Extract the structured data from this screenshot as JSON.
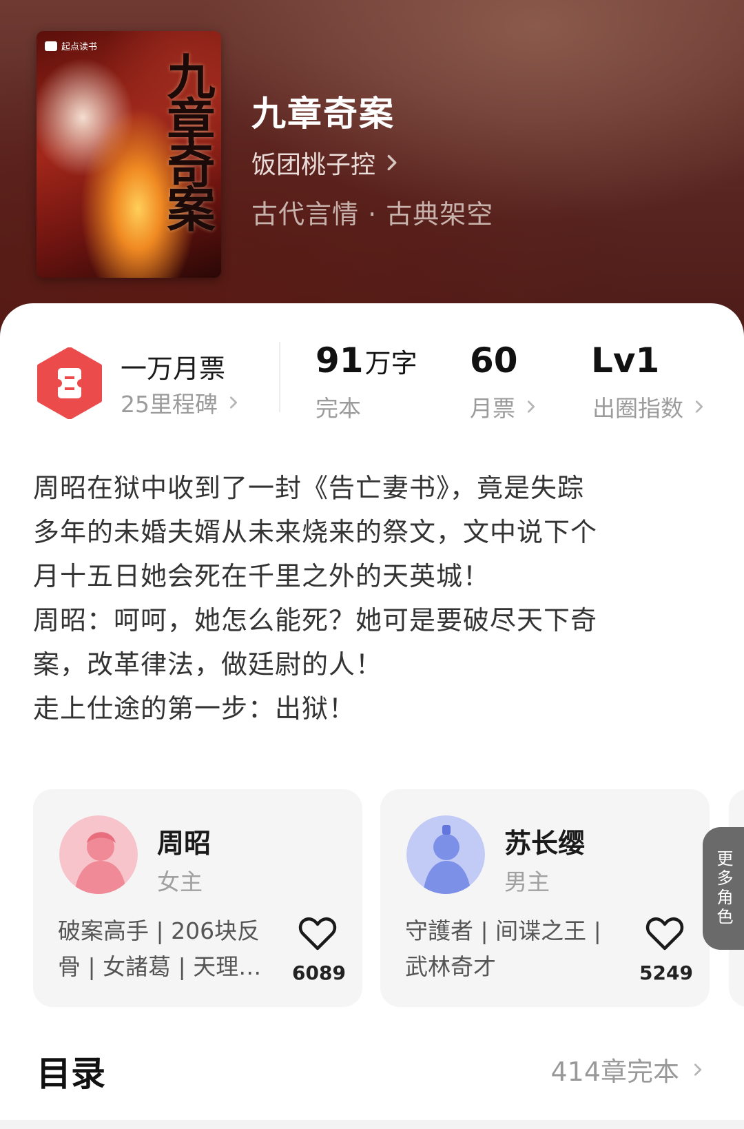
{
  "book": {
    "title": "九章奇案",
    "author": "饭团桃子控",
    "genre": "古代言情 · 古典架空",
    "cover": {
      "brand": "起点读书",
      "title_art": "九章奇案"
    }
  },
  "stats": {
    "ticket_title": "一万月票",
    "milestone": "25里程碑",
    "words_number": "91",
    "words_unit": "万字",
    "words_status": "完本",
    "monthly_votes": "60",
    "monthly_votes_label": "月票",
    "level": "Lv1",
    "level_label": "出圈指数"
  },
  "description": [
    "周昭在狱中收到了一封《告亡妻书》，竟是失踪",
    "多年的未婚夫婿从未来烧来的祭文，文中说下个",
    "月十五日她会死在千里之外的天英城！",
    "周昭：呵呵，她怎么能死？她可是要破尽天下奇",
    "案，改革律法，做廷尉的人！",
    "走上仕途的第一步：出狱！"
  ],
  "roles": [
    {
      "name": "周昭",
      "role": "女主",
      "tags_line1": "破案高手 | 206块反",
      "tags_line2": "骨 | 女諸葛 | 天理…",
      "likes": "6089",
      "avatar_color": "#f08a96"
    },
    {
      "name": "苏长缨",
      "role": "男主",
      "tags_line1": "守護者 | 间谍之王 |",
      "tags_line2": "武林奇才",
      "likes": "5249",
      "avatar_color": "#7d90e8"
    }
  ],
  "more_roles": "更多角色",
  "toc": {
    "title": "目录",
    "count": "414章完本"
  },
  "icons": {
    "ticket": "ticket-hexagon-icon",
    "heart": "heart-outline-icon",
    "chevron": "chevron-right-icon"
  },
  "colors": {
    "ticket_red": "#ec4b4b",
    "hero_bg": "#5a2622"
  }
}
